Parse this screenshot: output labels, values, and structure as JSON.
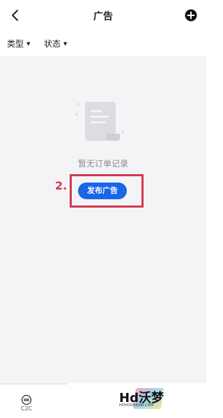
{
  "header": {
    "title": "广告"
  },
  "filters": [
    {
      "label": "类型"
    },
    {
      "label": "状态"
    }
  ],
  "empty_state": {
    "message": "暂无订单记录",
    "post_button_label": "发布广告"
  },
  "annotation": {
    "step_label": "2.",
    "color": "#d0384e"
  },
  "bottom_nav": {
    "c2c_label": "C2C"
  },
  "watermark": {
    "text": "Hd沃梦",
    "sub": "HDHODREAM.COM"
  },
  "colors": {
    "accent": "#1a66e8",
    "background": "#f4f4f6"
  }
}
